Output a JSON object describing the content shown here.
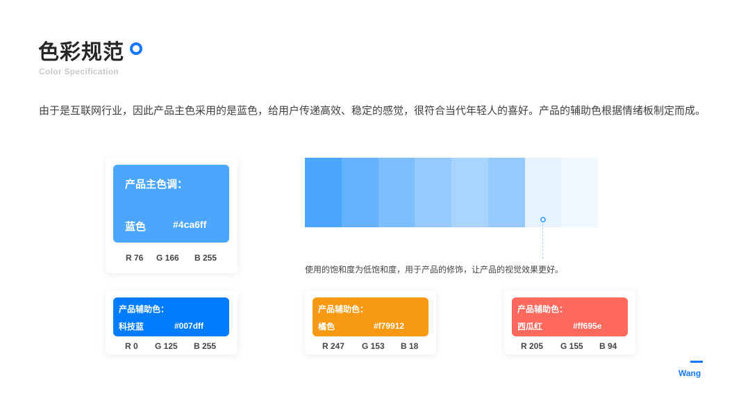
{
  "header": {
    "title": "色彩规范",
    "subtitle": "Color Specification",
    "intro": "由于是互联网行业，因此产品主色采用的是蓝色，给用户传递高效、稳定的感觉，很符合当代年轻人的喜好。产品的辅助色根据情绪板制定而成。"
  },
  "main_color": {
    "label": "产品主色调：",
    "name": "蓝色",
    "hex": "#4ca6ff",
    "color": "#4ca6ff",
    "r": "R 76",
    "g": "G 166",
    "b": "B 255"
  },
  "palette": {
    "shades": [
      "#4ca6ff",
      "#64b2ff",
      "#7cbeff",
      "#94caff",
      "#a9d4ff",
      "#94caff",
      "#e6f2ff",
      "#f2f8ff"
    ],
    "note": "使用的饱和度为低饱和度，用于产品的修饰，让产品的视觉效果更好。"
  },
  "aux_colors": [
    {
      "label": "产品辅助色：",
      "name": "科技蓝",
      "hex": "#007dff",
      "color": "#007dff",
      "r": "R 0",
      "g": "G 125",
      "b": "B 255"
    },
    {
      "label": "产品辅助色：",
      "name": "橘色",
      "hex": "#f79912",
      "color": "#f79912",
      "r": "R 247",
      "g": "G 153",
      "b": "B 18"
    },
    {
      "label": "产品辅助色：",
      "name": "西瓜红",
      "hex": "#ff695e",
      "color": "#ff695e",
      "r": "R 205",
      "g": "G 155",
      "b": "B 94"
    }
  ],
  "accent_color": "#1677ff",
  "brand": "Wang"
}
